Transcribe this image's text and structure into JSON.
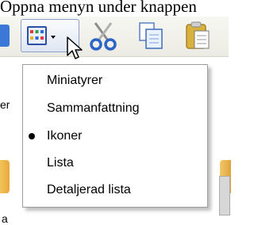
{
  "caption": "Öppna menyn under knappen",
  "toolbar": {
    "icons": [
      "views-icon",
      "cut-icon",
      "copy-icon",
      "paste-icon"
    ]
  },
  "background": {
    "edge_text_top": "er",
    "edge_text_bottom": "a"
  },
  "menu": {
    "items": [
      {
        "label": "Miniatyrer",
        "selected": false
      },
      {
        "label": "Sammanfattning",
        "selected": false
      },
      {
        "label": "Ikoner",
        "selected": true
      },
      {
        "label": "Lista",
        "selected": false
      },
      {
        "label": "Detaljerad lista",
        "selected": false
      }
    ]
  },
  "colors": {
    "toolbar_bg": "#ecebe3",
    "views_button_border": "#8aa0c8",
    "menu_bg": "#ffffff",
    "menu_border": "#9d9d9d",
    "cut_icon": "#2c63c7",
    "paste_icon": "#d8b23e"
  }
}
